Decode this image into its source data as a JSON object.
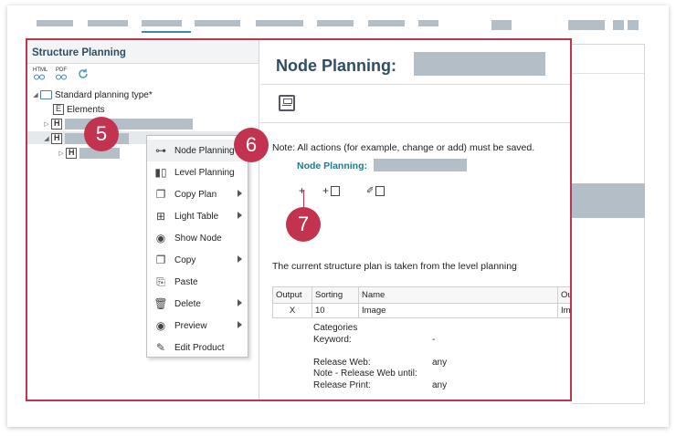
{
  "left_panel": {
    "title": "Structure Planning",
    "toolbar": {
      "html_icon": "HTML",
      "pdf_icon": "PDF"
    },
    "tree": {
      "root_label": "Standard planning type*",
      "elements_label": "Elements"
    }
  },
  "context_menu": {
    "items": [
      {
        "label": "Node Planning",
        "icon": "node-link-icon",
        "submenu": false
      },
      {
        "label": "Level Planning",
        "icon": "bars-icon",
        "submenu": false
      },
      {
        "label": "Copy Plan",
        "icon": "copy-icon",
        "submenu": true
      },
      {
        "label": "Light Table",
        "icon": "grid-icon",
        "submenu": true
      },
      {
        "label": "Show Node",
        "icon": "eye-icon",
        "submenu": false
      },
      {
        "label": "Copy",
        "icon": "copy-icon",
        "submenu": true
      },
      {
        "label": "Paste",
        "icon": "paste-icon",
        "submenu": false
      },
      {
        "label": "Delete",
        "icon": "trash-icon",
        "submenu": true
      },
      {
        "label": "Preview",
        "icon": "eye-icon",
        "submenu": true
      },
      {
        "label": "Edit Product",
        "icon": "pencil-icon",
        "submenu": false
      }
    ]
  },
  "right_panel": {
    "title": "Node Planning:",
    "note": "Note: All actions (for example, change or add) must be saved.",
    "node_planning_label": "Node Planning:",
    "current_plan_text": "The current structure plan is taken from the level planning",
    "table": {
      "headers": [
        "Output",
        "Sorting",
        "Name",
        "Ou"
      ],
      "rows": [
        [
          "X",
          "10",
          "Image",
          "Ima"
        ]
      ]
    },
    "details": [
      {
        "key": "Categories",
        "value": ""
      },
      {
        "key": "Keyword:",
        "value": "-"
      },
      {
        "key": "",
        "value": ""
      },
      {
        "key": "Release Web:",
        "value": "any"
      },
      {
        "key": "Note - Release Web until:",
        "value": ""
      },
      {
        "key": "Release Print:",
        "value": "any"
      }
    ]
  },
  "callouts": [
    "5",
    "6",
    "7"
  ],
  "colors": {
    "highlight": "#c2334f",
    "title": "#2e4e63",
    "teal_label": "#1f7c86",
    "mask": "#b4bec6"
  }
}
